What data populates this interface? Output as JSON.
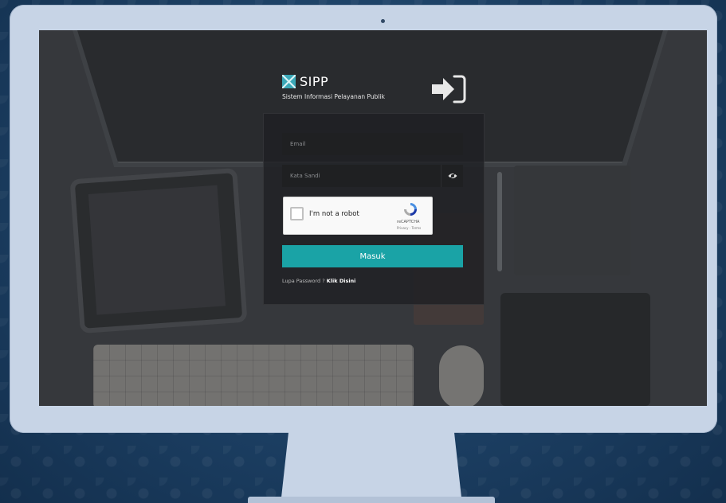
{
  "brand": {
    "title": "SIPP",
    "subtitle": "Sistem Informasi Pelayanan Publik"
  },
  "login": {
    "email_placeholder": "Email",
    "password_placeholder": "Kata Sandi",
    "recaptcha": {
      "label": "I'm not a robot",
      "brand": "reCAPTCHA",
      "terms": "Privacy - Terms"
    },
    "submit_label": "Masuk",
    "forgot_text": "Lupa Password ? ",
    "forgot_link": "Klik Disini"
  },
  "colors": {
    "accent": "#1aa3a6",
    "logo": "#3aa8b8"
  },
  "icons": {
    "login": "sign-in-icon",
    "password_toggle": "eye-icon",
    "recaptcha": "recaptcha-logo-icon"
  }
}
